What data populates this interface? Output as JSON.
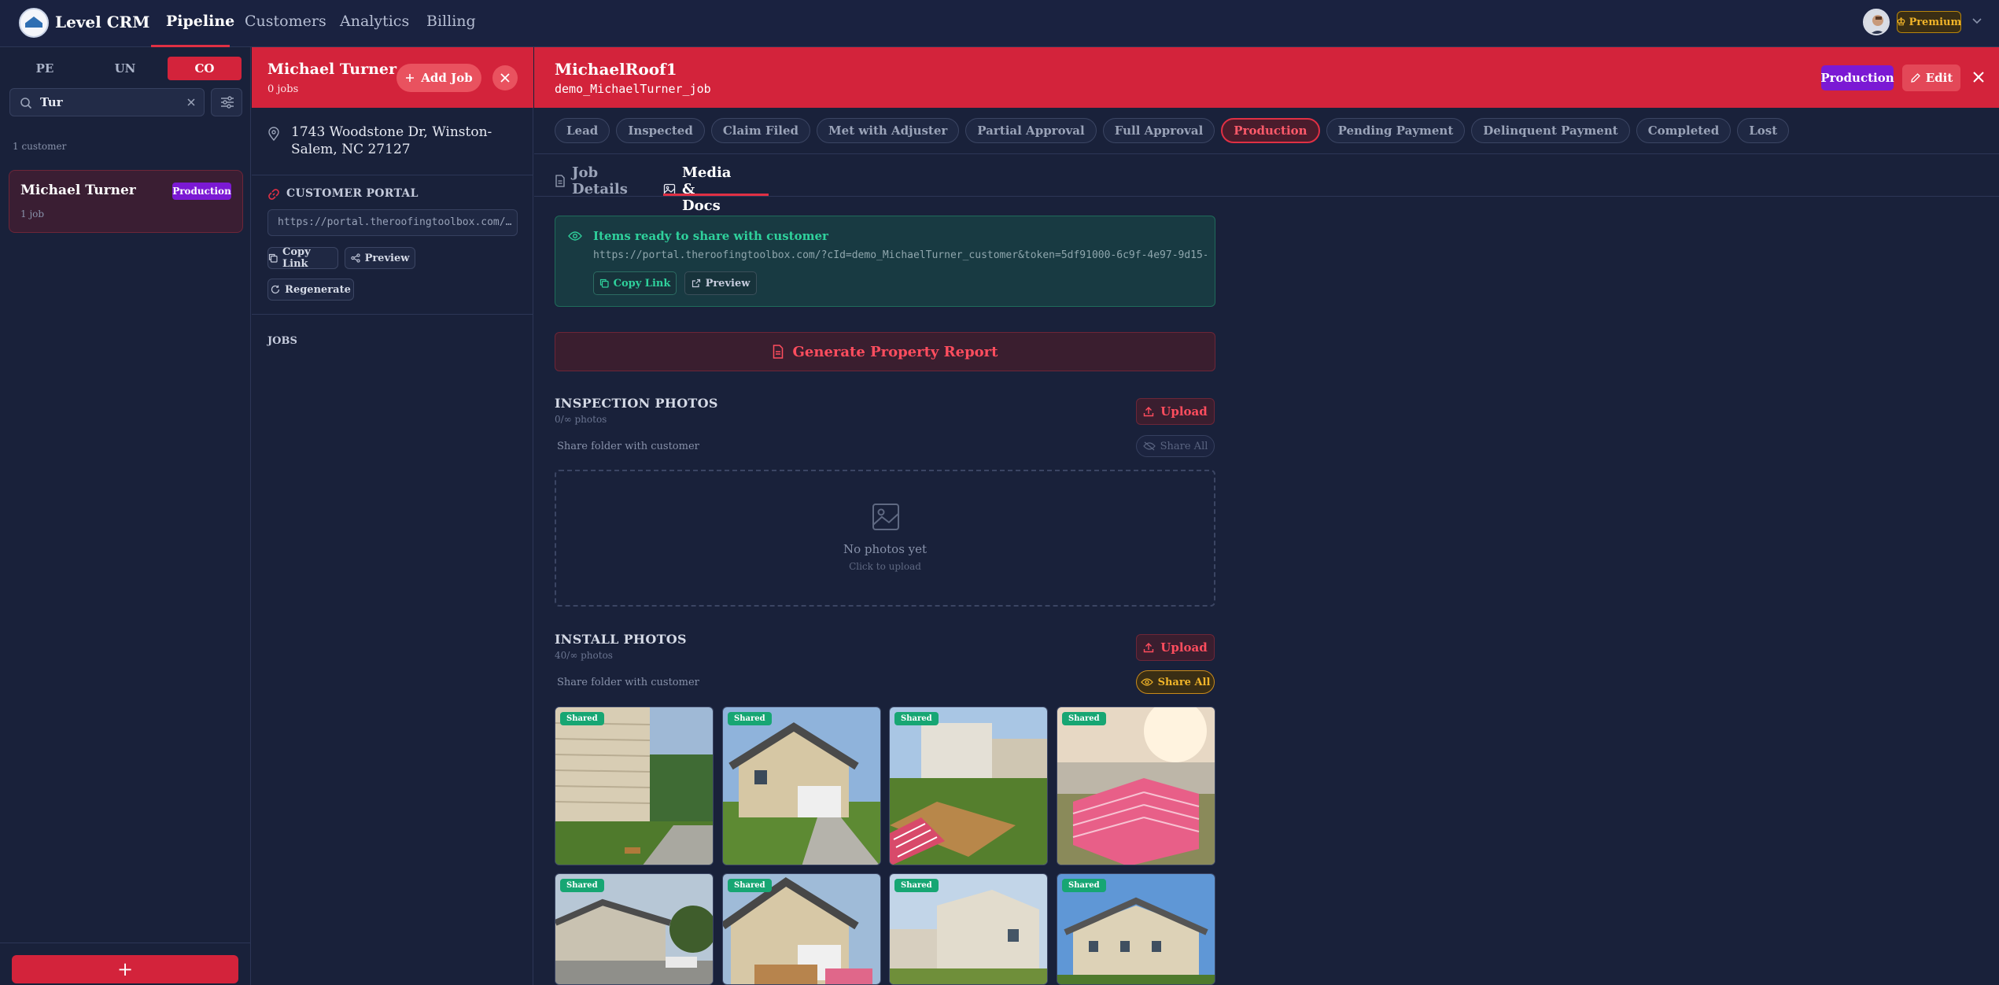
{
  "app": {
    "name": "Level CRM"
  },
  "nav": {
    "items": [
      "Pipeline",
      "Customers",
      "Analytics",
      "Billing"
    ],
    "active": "Pipeline"
  },
  "user": {
    "plan": "Premium"
  },
  "sidebar": {
    "segments": [
      "PE",
      "UN",
      "CO"
    ],
    "active_segment": "CO",
    "search_value": "Tur",
    "count_text": "1 customer",
    "customers": [
      {
        "name": "Michael Turner",
        "badge": "Production",
        "sub": "1 job"
      }
    ],
    "add_label": "+"
  },
  "customer_panel": {
    "name": "Michael Turner",
    "jobs_count": "0 jobs",
    "add_job_label": "Add Job",
    "address": "1743 Woodstone Dr, Winston-Salem, NC 27127",
    "portal_label": "CUSTOMER PORTAL",
    "portal_url": "https://portal.theroofingtoolbox.com/…",
    "copy_link_label": "Copy Link",
    "preview_label": "Preview",
    "regenerate_label": "Regenerate",
    "jobs_label": "JOBS"
  },
  "job_panel": {
    "title": "MichaelRoof1",
    "job_id": "demo_MichaelTurner_job",
    "status_badge": "Production",
    "edit_label": "Edit",
    "stages": [
      "Lead",
      "Inspected",
      "Claim Filed",
      "Met with Adjuster",
      "Partial Approval",
      "Full Approval",
      "Production",
      "Pending Payment",
      "Delinquent Payment",
      "Completed",
      "Lost"
    ],
    "active_stage": "Production",
    "tabs": [
      "Job Details",
      "Media & Docs"
    ],
    "active_tab": "Media & Docs",
    "share": {
      "title": "Items ready to share with customer",
      "url": "https://portal.theroofingtoolbox.com/?cId=demo_MichaelTurner_customer&token=5df91000-6c9f-4e97-9d15-1c…",
      "copy_label": "Copy Link",
      "preview_label": "Preview"
    },
    "report_label": "Generate Property Report",
    "inspection": {
      "title": "INSPECTION PHOTOS",
      "count": "0/∞ photos",
      "share_label": "Share folder with customer",
      "upload_label": "Upload",
      "share_all_label": "Share All",
      "empty_title": "No photos yet",
      "empty_sub": "Click to upload"
    },
    "install": {
      "title": "INSTALL PHOTOS",
      "count": "40/∞ photos",
      "share_label": "Share folder with customer",
      "upload_label": "Upload",
      "share_all_label": "Share All",
      "photo_tag": "Shared"
    }
  },
  "colors": {
    "accent": "#d3233b",
    "production": "#7b19d4",
    "shared": "#17a673",
    "premium": "#f0b429",
    "bg": "#19213a"
  }
}
